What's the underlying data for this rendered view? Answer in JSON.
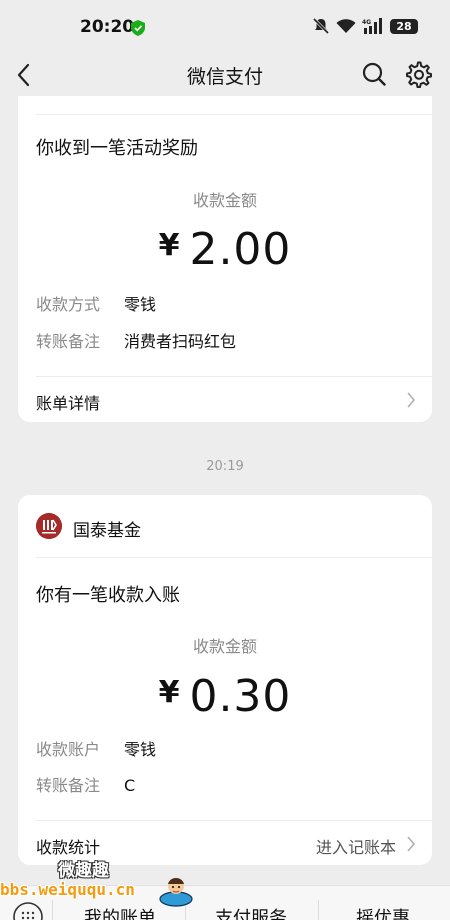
{
  "status_bar": {
    "time": "20:20",
    "battery": "28",
    "network": "4G"
  },
  "nav": {
    "title": "微信支付"
  },
  "card1": {
    "headline": "你收到一笔活动奖励",
    "amount_label": "收款金额",
    "currency": "¥",
    "amount": "2.00",
    "rows": [
      {
        "key": "收款方式",
        "value": "零钱"
      },
      {
        "key": "转账备注",
        "value": "消费者扫码红包"
      }
    ],
    "footer_link": "账单详情"
  },
  "timestamp": "20:19",
  "card2": {
    "brand_name": "国泰基金",
    "headline": "你有一笔收款入账",
    "amount_label": "收款金额",
    "currency": "¥",
    "amount": "0.30",
    "rows": [
      {
        "key": "收款账户",
        "value": "零钱"
      },
      {
        "key": "转账备注",
        "value": "C"
      }
    ],
    "footer_link": "收款统计",
    "footer_action": "进入记账本"
  },
  "bottom_menu": {
    "items": [
      "我的账单",
      "支付服务",
      "摇优惠"
    ]
  },
  "watermark": {
    "title": "微趣趣",
    "url": "bbs.weiququ.cn"
  },
  "colors": {
    "background": "#ededed",
    "card": "#ffffff",
    "brand_logo": "#a52a2a",
    "watermark_url": "#f39c12"
  }
}
